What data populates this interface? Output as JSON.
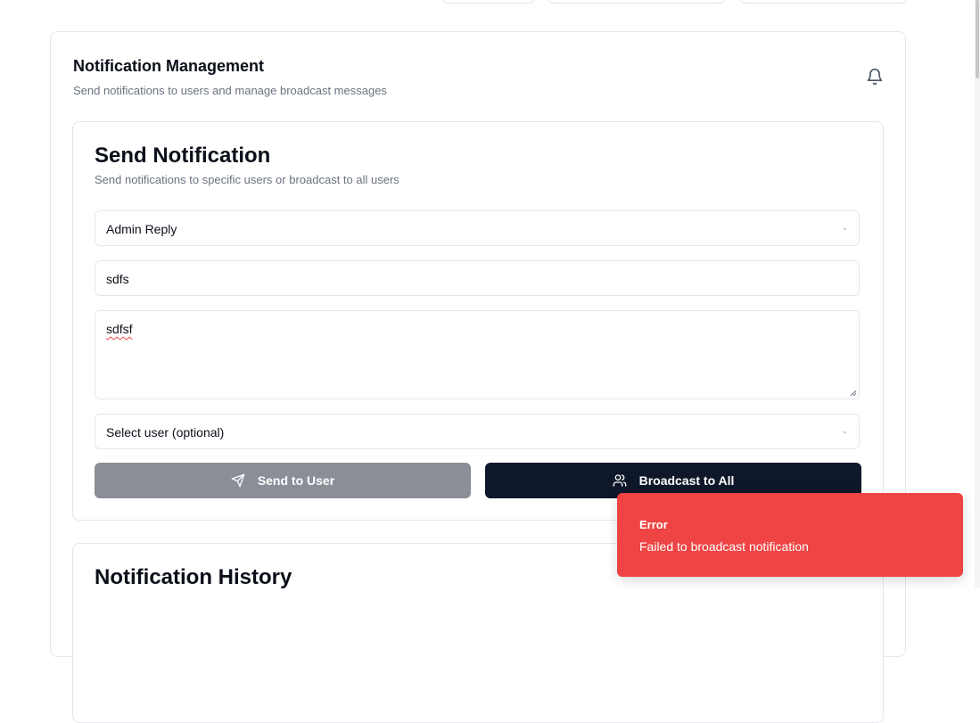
{
  "notification_management": {
    "title": "Notification Management",
    "subtitle": "Send notifications to users and manage broadcast messages",
    "icon": "bell-icon"
  },
  "send_notification": {
    "title": "Send Notification",
    "subtitle": "Send notifications to specific users or broadcast to all users",
    "type_select": {
      "value": "Admin Reply"
    },
    "title_input": {
      "value": "sdfs"
    },
    "message_input": {
      "value": "sdfsf"
    },
    "user_select": {
      "value": "Select user (optional)"
    },
    "send_to_user_label": "Send to User",
    "broadcast_label": "Broadcast to All"
  },
  "notification_history": {
    "title": "Notification History"
  },
  "toast": {
    "title": "Error",
    "message": "Failed to broadcast notification",
    "color": "#ef4444"
  }
}
